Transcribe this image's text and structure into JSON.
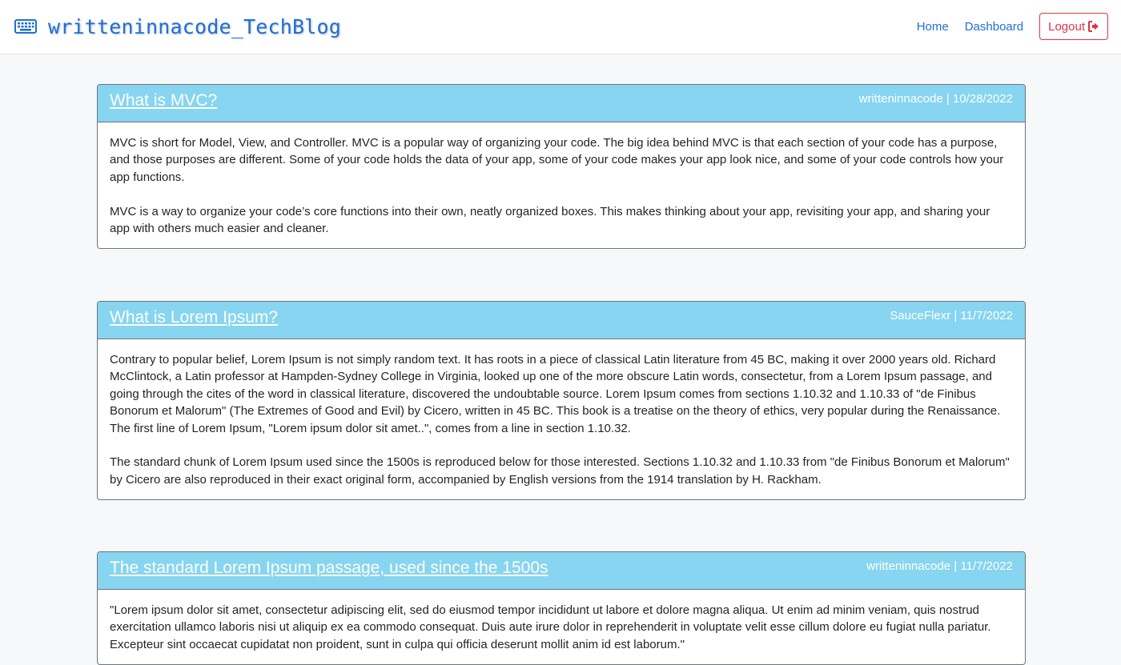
{
  "navbar": {
    "brand": "writteninnacode_TechBlog",
    "brand_icon": "keyboard-icon",
    "links": {
      "home": "Home",
      "dashboard": "Dashboard",
      "logout": "Logout"
    },
    "logout_icon": "sign-out-icon"
  },
  "colors": {
    "accent": "#1e6fd9",
    "post_header": "#87d5f0",
    "logout": "#dc3545",
    "background": "#f7f8fa"
  },
  "posts": [
    {
      "title": "What is MVC?",
      "meta": "writteninnacode | 10/28/2022",
      "paragraphs": [
        "MVC is short for Model, View, and Controller. MVC is a popular way of organizing your code. The big idea behind MVC is that each section of your code has a purpose, and those purposes are different. Some of your code holds the data of your app, some of your code makes your app look nice, and some of your code controls how your app functions.",
        "MVC is a way to organize your code’s core functions into their own, neatly organized boxes. This makes thinking about your app, revisiting your app, and sharing your app with others much easier and cleaner."
      ]
    },
    {
      "title": "What is Lorem Ipsum?",
      "meta": "SauceFlexr | 11/7/2022",
      "paragraphs": [
        "Contrary to popular belief, Lorem Ipsum is not simply random text. It has roots in a piece of classical Latin literature from 45 BC, making it over 2000 years old. Richard McClintock, a Latin professor at Hampden-Sydney College in Virginia, looked up one of the more obscure Latin words, consectetur, from a Lorem Ipsum passage, and going through the cites of the word in classical literature, discovered the undoubtable source. Lorem Ipsum comes from sections 1.10.32 and 1.10.33 of \"de Finibus Bonorum et Malorum\" (The Extremes of Good and Evil) by Cicero, written in 45 BC. This book is a treatise on the theory of ethics, very popular during the Renaissance. The first line of Lorem Ipsum, \"Lorem ipsum dolor sit amet..\", comes from a line in section 1.10.32.",
        "The standard chunk of Lorem Ipsum used since the 1500s is reproduced below for those interested. Sections 1.10.32 and 1.10.33 from \"de Finibus Bonorum et Malorum\" by Cicero are also reproduced in their exact original form, accompanied by English versions from the 1914 translation by H. Rackham."
      ]
    },
    {
      "title": "The standard Lorem Ipsum passage, used since the 1500s",
      "meta": "writteninnacode | 11/7/2022",
      "paragraphs": [
        "\"Lorem ipsum dolor sit amet, consectetur adipiscing elit, sed do eiusmod tempor incididunt ut labore et dolore magna aliqua. Ut enim ad minim veniam, quis nostrud exercitation ullamco laboris nisi ut aliquip ex ea commodo consequat. Duis aute irure dolor in reprehenderit in voluptate velit esse cillum dolore eu fugiat nulla pariatur. Excepteur sint occaecat cupidatat non proident, sunt in culpa qui officia deserunt mollit anim id est laborum.\""
      ]
    }
  ]
}
